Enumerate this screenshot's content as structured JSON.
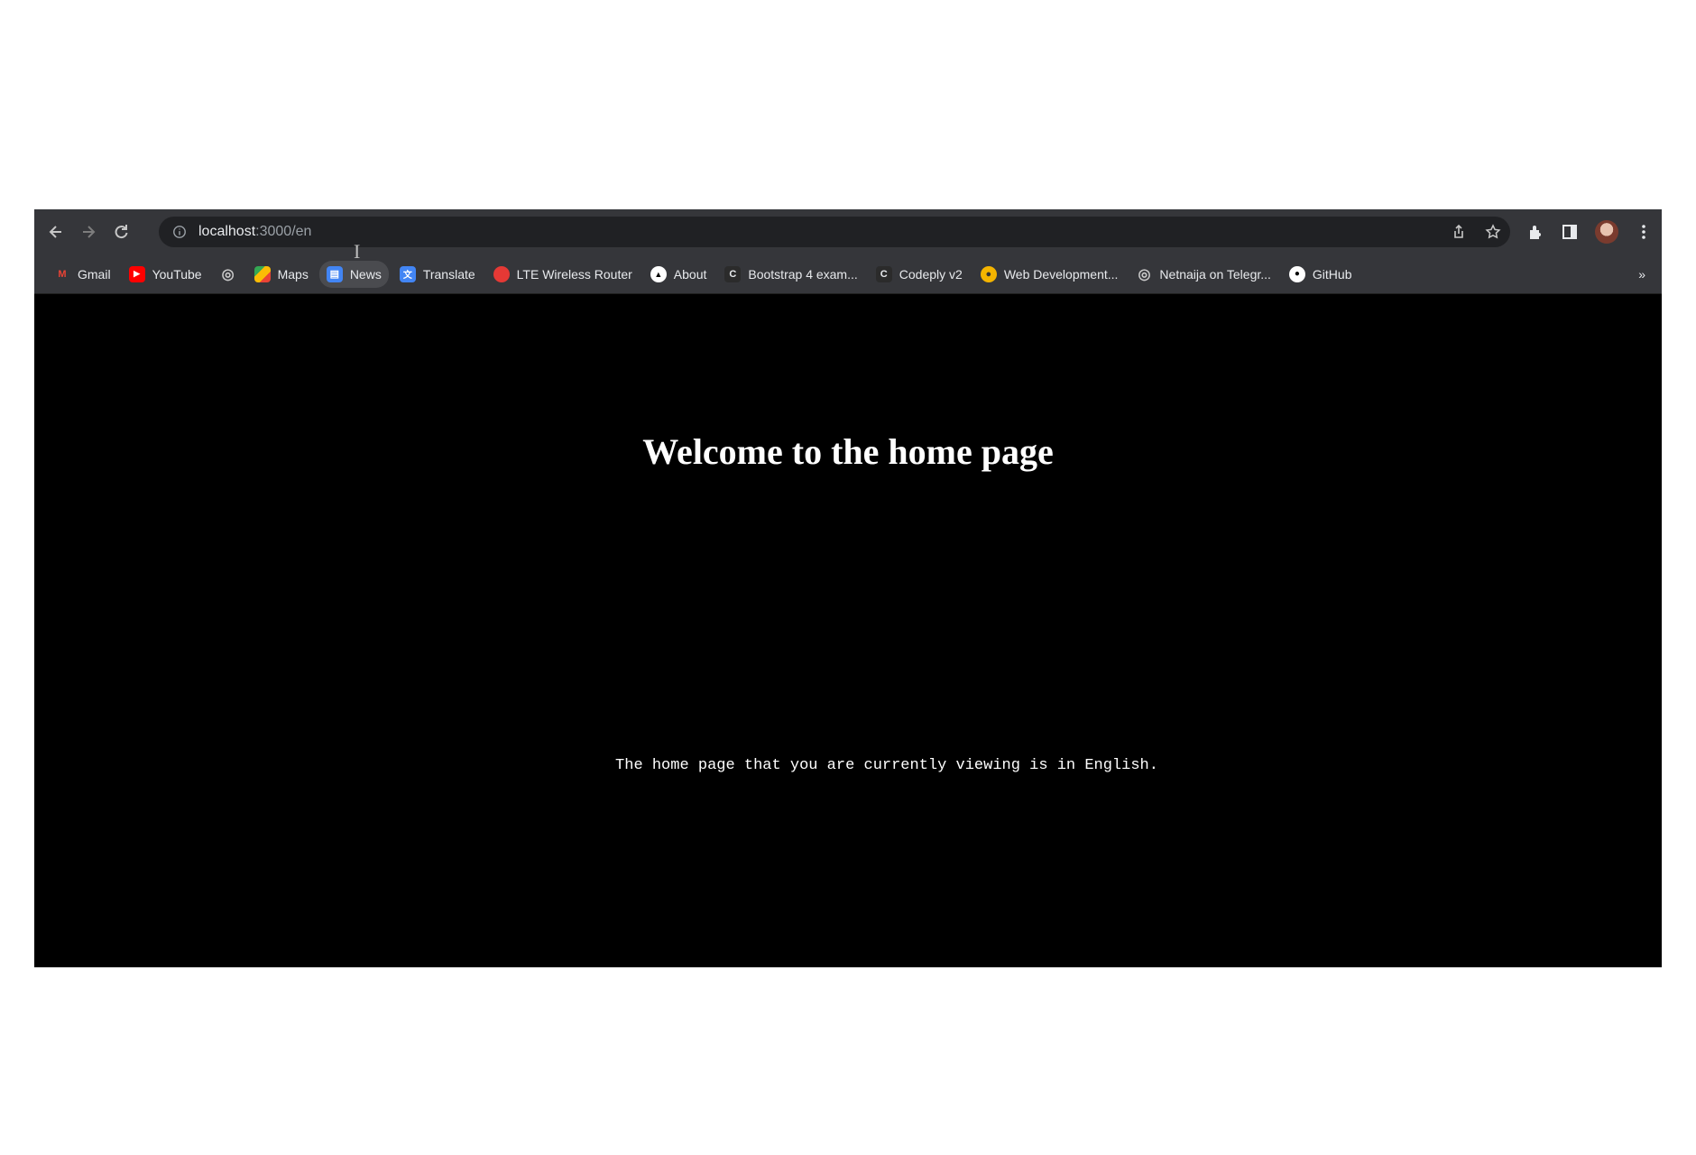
{
  "browser": {
    "url_host": "localhost",
    "url_rest": ":3000/en"
  },
  "bookmarks": [
    {
      "label": "Gmail",
      "icon": "gmail-icon",
      "color": "#ea4335",
      "glyph": "M"
    },
    {
      "label": "YouTube",
      "icon": "youtube-icon",
      "color": "#ff0000",
      "glyph": "▶"
    },
    {
      "label": "",
      "icon": "globe-icon",
      "color": "#5f6368",
      "glyph": "◎"
    },
    {
      "label": "Maps",
      "icon": "maps-icon",
      "color": "#34a853",
      "glyph": "✦"
    },
    {
      "label": "News",
      "icon": "news-icon",
      "color": "#4285f4",
      "glyph": "▤"
    },
    {
      "label": "Translate",
      "icon": "translate-icon",
      "color": "#4285f4",
      "glyph": "文"
    },
    {
      "label": "LTE Wireless Router",
      "icon": "router-icon",
      "color": "#e53935",
      "glyph": "●"
    },
    {
      "label": "About",
      "icon": "about-icon",
      "color": "#202124",
      "glyph": "▲"
    },
    {
      "label": "Bootstrap 4 exam...",
      "icon": "codeply-icon",
      "color": "#2b2b2b",
      "glyph": "C"
    },
    {
      "label": "Codeply v2",
      "icon": "codeply-icon",
      "color": "#2b2b2b",
      "glyph": "C"
    },
    {
      "label": "Web Development...",
      "icon": "webdev-icon",
      "color": "#f4b400",
      "glyph": "●"
    },
    {
      "label": "Netnaija on Telegr...",
      "icon": "globe-icon",
      "color": "#5f6368",
      "glyph": "◎"
    },
    {
      "label": "GitHub",
      "icon": "github-icon",
      "color": "#ffffff",
      "glyph": "●"
    }
  ],
  "page": {
    "heading": "Welcome to the home page",
    "language_note": "The home page that you are currently viewing is in English."
  }
}
